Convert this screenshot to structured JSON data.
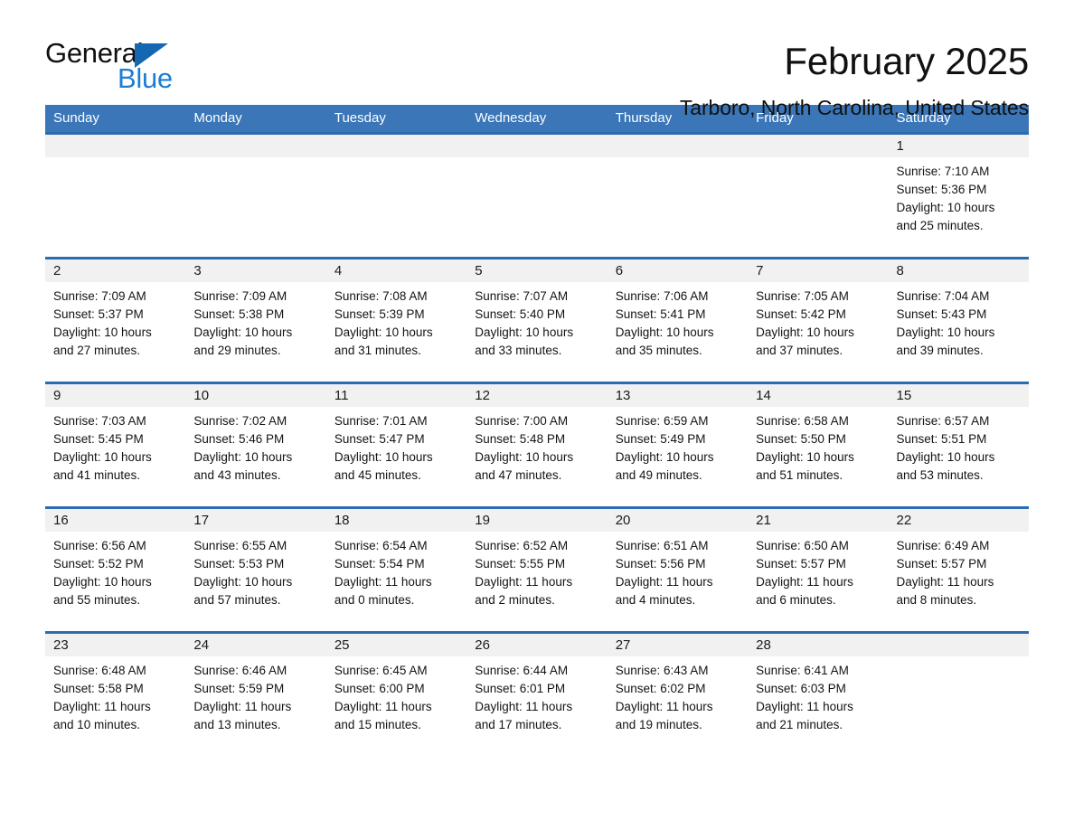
{
  "brand": {
    "word1": "General",
    "word2": "Blue",
    "triangle_icon": "brand-triangle-icon",
    "colors": {
      "word1": "#101010",
      "word2": "#1c7fd4",
      "triangle": "#1667b2"
    }
  },
  "header": {
    "title": "February 2025",
    "subtitle": "Tarboro, North Carolina, United States"
  },
  "theme": {
    "header_blue": "#3a76b8",
    "row_rule_blue": "#2b6cb0",
    "day_band_gray": "#f1f1f1",
    "text": "#141414"
  },
  "calendar": {
    "weekdays": [
      "Sunday",
      "Monday",
      "Tuesday",
      "Wednesday",
      "Thursday",
      "Friday",
      "Saturday"
    ],
    "weeks": [
      [
        {
          "day": "",
          "lines": []
        },
        {
          "day": "",
          "lines": []
        },
        {
          "day": "",
          "lines": []
        },
        {
          "day": "",
          "lines": []
        },
        {
          "day": "",
          "lines": []
        },
        {
          "day": "",
          "lines": []
        },
        {
          "day": "1",
          "lines": [
            "Sunrise: 7:10 AM",
            "Sunset: 5:36 PM",
            "Daylight: 10 hours",
            "and 25 minutes."
          ]
        }
      ],
      [
        {
          "day": "2",
          "lines": [
            "Sunrise: 7:09 AM",
            "Sunset: 5:37 PM",
            "Daylight: 10 hours",
            "and 27 minutes."
          ]
        },
        {
          "day": "3",
          "lines": [
            "Sunrise: 7:09 AM",
            "Sunset: 5:38 PM",
            "Daylight: 10 hours",
            "and 29 minutes."
          ]
        },
        {
          "day": "4",
          "lines": [
            "Sunrise: 7:08 AM",
            "Sunset: 5:39 PM",
            "Daylight: 10 hours",
            "and 31 minutes."
          ]
        },
        {
          "day": "5",
          "lines": [
            "Sunrise: 7:07 AM",
            "Sunset: 5:40 PM",
            "Daylight: 10 hours",
            "and 33 minutes."
          ]
        },
        {
          "day": "6",
          "lines": [
            "Sunrise: 7:06 AM",
            "Sunset: 5:41 PM",
            "Daylight: 10 hours",
            "and 35 minutes."
          ]
        },
        {
          "day": "7",
          "lines": [
            "Sunrise: 7:05 AM",
            "Sunset: 5:42 PM",
            "Daylight: 10 hours",
            "and 37 minutes."
          ]
        },
        {
          "day": "8",
          "lines": [
            "Sunrise: 7:04 AM",
            "Sunset: 5:43 PM",
            "Daylight: 10 hours",
            "and 39 minutes."
          ]
        }
      ],
      [
        {
          "day": "9",
          "lines": [
            "Sunrise: 7:03 AM",
            "Sunset: 5:45 PM",
            "Daylight: 10 hours",
            "and 41 minutes."
          ]
        },
        {
          "day": "10",
          "lines": [
            "Sunrise: 7:02 AM",
            "Sunset: 5:46 PM",
            "Daylight: 10 hours",
            "and 43 minutes."
          ]
        },
        {
          "day": "11",
          "lines": [
            "Sunrise: 7:01 AM",
            "Sunset: 5:47 PM",
            "Daylight: 10 hours",
            "and 45 minutes."
          ]
        },
        {
          "day": "12",
          "lines": [
            "Sunrise: 7:00 AM",
            "Sunset: 5:48 PM",
            "Daylight: 10 hours",
            "and 47 minutes."
          ]
        },
        {
          "day": "13",
          "lines": [
            "Sunrise: 6:59 AM",
            "Sunset: 5:49 PM",
            "Daylight: 10 hours",
            "and 49 minutes."
          ]
        },
        {
          "day": "14",
          "lines": [
            "Sunrise: 6:58 AM",
            "Sunset: 5:50 PM",
            "Daylight: 10 hours",
            "and 51 minutes."
          ]
        },
        {
          "day": "15",
          "lines": [
            "Sunrise: 6:57 AM",
            "Sunset: 5:51 PM",
            "Daylight: 10 hours",
            "and 53 minutes."
          ]
        }
      ],
      [
        {
          "day": "16",
          "lines": [
            "Sunrise: 6:56 AM",
            "Sunset: 5:52 PM",
            "Daylight: 10 hours",
            "and 55 minutes."
          ]
        },
        {
          "day": "17",
          "lines": [
            "Sunrise: 6:55 AM",
            "Sunset: 5:53 PM",
            "Daylight: 10 hours",
            "and 57 minutes."
          ]
        },
        {
          "day": "18",
          "lines": [
            "Sunrise: 6:54 AM",
            "Sunset: 5:54 PM",
            "Daylight: 11 hours",
            "and 0 minutes."
          ]
        },
        {
          "day": "19",
          "lines": [
            "Sunrise: 6:52 AM",
            "Sunset: 5:55 PM",
            "Daylight: 11 hours",
            "and 2 minutes."
          ]
        },
        {
          "day": "20",
          "lines": [
            "Sunrise: 6:51 AM",
            "Sunset: 5:56 PM",
            "Daylight: 11 hours",
            "and 4 minutes."
          ]
        },
        {
          "day": "21",
          "lines": [
            "Sunrise: 6:50 AM",
            "Sunset: 5:57 PM",
            "Daylight: 11 hours",
            "and 6 minutes."
          ]
        },
        {
          "day": "22",
          "lines": [
            "Sunrise: 6:49 AM",
            "Sunset: 5:57 PM",
            "Daylight: 11 hours",
            "and 8 minutes."
          ]
        }
      ],
      [
        {
          "day": "23",
          "lines": [
            "Sunrise: 6:48 AM",
            "Sunset: 5:58 PM",
            "Daylight: 11 hours",
            "and 10 minutes."
          ]
        },
        {
          "day": "24",
          "lines": [
            "Sunrise: 6:46 AM",
            "Sunset: 5:59 PM",
            "Daylight: 11 hours",
            "and 13 minutes."
          ]
        },
        {
          "day": "25",
          "lines": [
            "Sunrise: 6:45 AM",
            "Sunset: 6:00 PM",
            "Daylight: 11 hours",
            "and 15 minutes."
          ]
        },
        {
          "day": "26",
          "lines": [
            "Sunrise: 6:44 AM",
            "Sunset: 6:01 PM",
            "Daylight: 11 hours",
            "and 17 minutes."
          ]
        },
        {
          "day": "27",
          "lines": [
            "Sunrise: 6:43 AM",
            "Sunset: 6:02 PM",
            "Daylight: 11 hours",
            "and 19 minutes."
          ]
        },
        {
          "day": "28",
          "lines": [
            "Sunrise: 6:41 AM",
            "Sunset: 6:03 PM",
            "Daylight: 11 hours",
            "and 21 minutes."
          ]
        },
        {
          "day": "",
          "lines": []
        }
      ]
    ]
  }
}
